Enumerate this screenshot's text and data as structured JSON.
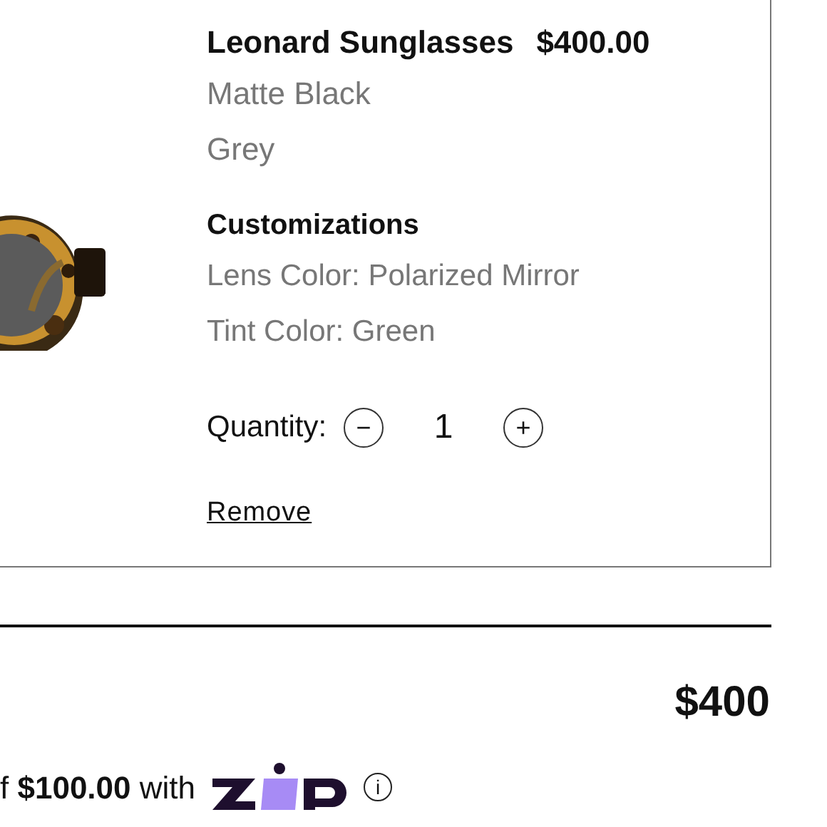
{
  "item": {
    "name": "Leonard Sunglasses",
    "price": "$400.00",
    "details": [
      "Matte Black",
      "Grey"
    ],
    "customizations_heading": "Customizations",
    "customizations": [
      "Lens Color: Polarized Mirror",
      "Tint Color: Green"
    ],
    "quantity_label": "Quantity:",
    "quantity": "1",
    "decrease": "−",
    "increase": "+",
    "remove": "Remove"
  },
  "total": "$400",
  "installment": "f **$100.00** with",
  "info": "i"
}
